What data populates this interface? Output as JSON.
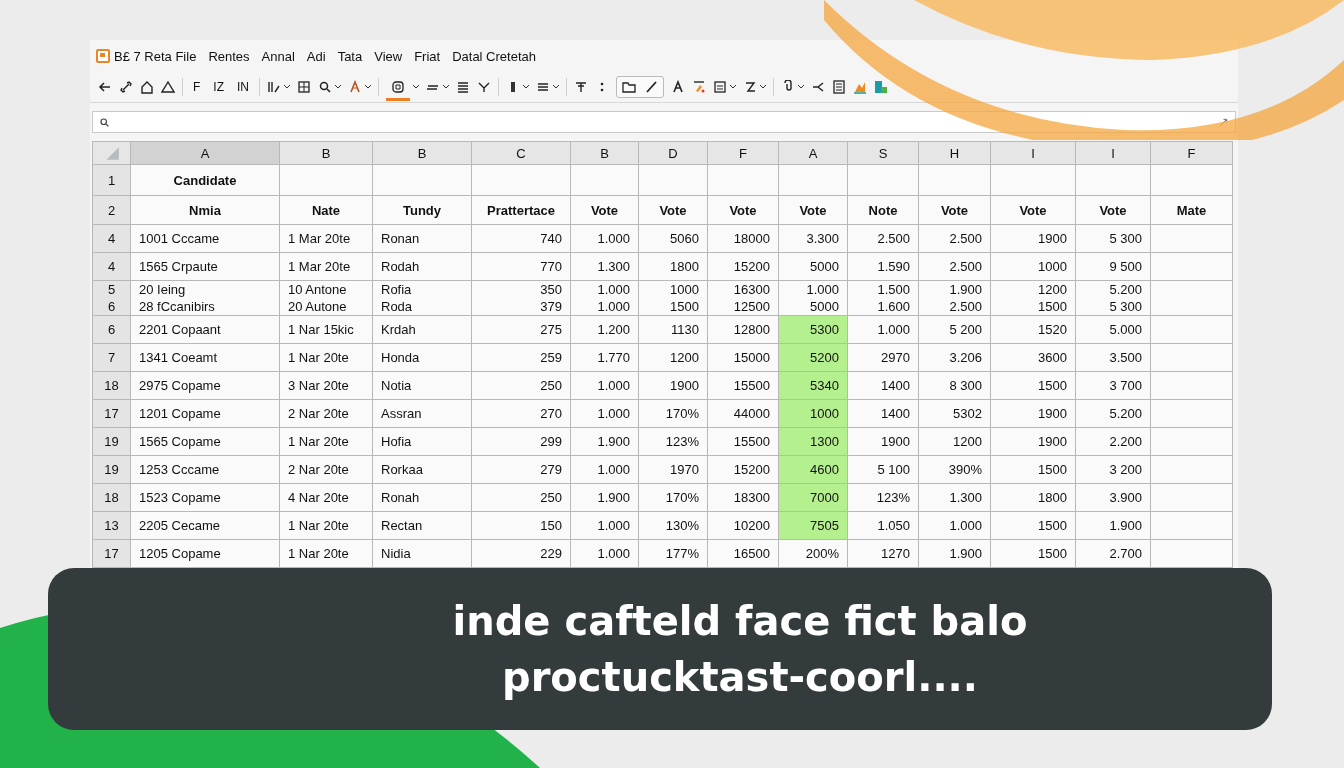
{
  "menu": [
    "B£ 7 Reta File",
    "Rentes",
    "Annal",
    "Adi",
    "Tata",
    "View",
    "Friat",
    "Datal Cretetah"
  ],
  "toolbar_labels": [
    "F",
    "IZ",
    "IN"
  ],
  "columns": [
    "A",
    "B",
    "B",
    "C",
    "B",
    "D",
    "F",
    "A",
    "S",
    "H",
    "I",
    "I",
    "F"
  ],
  "title_row": {
    "header": "1",
    "label": "Candidate"
  },
  "heading_row": {
    "header": "2",
    "labels": [
      "Nmia",
      "Nate",
      "Tundy",
      "Prattertace",
      "Vote",
      "Vote",
      "Vote",
      "Vote",
      "Note",
      "Vote",
      "Vote",
      "Vote",
      "Mate"
    ]
  },
  "rows": [
    {
      "header": "4",
      "highlighted": false,
      "cells": [
        "1001 Cccame",
        "1 Mar 20te",
        "Ronan",
        "740",
        "1.000",
        "5060",
        "18000",
        "3.300",
        "2.500",
        "2.500",
        "1900",
        "5 300"
      ]
    },
    {
      "header": "4",
      "highlighted": false,
      "cells": [
        "1565 Crpaute",
        "1 Mar 20te",
        "Rodah",
        "770",
        "1.300",
        "1800",
        "15200",
        "5000",
        "1.590",
        "2.500",
        "1000",
        "9 500"
      ]
    },
    {
      "header": "5\n6",
      "highlighted": false,
      "cells": [
        "20 Ieing\n28 fCcanibirs",
        "10 Antone\n20 Autone",
        "Rofia\nRoda",
        "350\n379",
        "1.000\n1.000",
        "1000\n1500",
        "16300\n12500",
        "1.000\n5000",
        "1.500\n1.600",
        "1.900\n2.500",
        "1200\n1500",
        "5.200\n5 300"
      ]
    },
    {
      "header": "6",
      "highlighted": true,
      "cells": [
        "2201 Copaant",
        "1 Nar 15kic",
        "Krdah",
        "275",
        "1.200",
        "1130",
        "12800",
        "5300",
        "1.000",
        "5 200",
        "1520",
        "5.000"
      ]
    },
    {
      "header": "7",
      "highlighted": true,
      "cells": [
        "1341 Coeamt",
        "1 Nar 20te",
        "Honda",
        "259",
        "1.770",
        "1200",
        "15000",
        "5200",
        "2970",
        "3.206",
        "3600",
        "3.500"
      ]
    },
    {
      "header": "18",
      "highlighted": true,
      "cells": [
        "2975 Copame",
        "3 Nar 20te",
        "Notia",
        "250",
        "1.000",
        "1900",
        "15500",
        "5340",
        "1400",
        "8 300",
        "1500",
        "3 700"
      ]
    },
    {
      "header": "17",
      "highlighted": true,
      "cells": [
        "1201 Copame",
        "2 Nar 20te",
        "Assran",
        "270",
        "1.000",
        "170%",
        "44000",
        "1000",
        "1400",
        "5302",
        "1900",
        "5.200"
      ]
    },
    {
      "header": "19",
      "highlighted": true,
      "cells": [
        "1565 Copame",
        "1 Nar 20te",
        "Hofia",
        "299",
        "1.900",
        "123%",
        "15500",
        "1300",
        "1900",
        "1200",
        "1900",
        "2.200"
      ]
    },
    {
      "header": "19",
      "highlighted": true,
      "cells": [
        "1253 Cccame",
        "2 Nar 20te",
        "Rorkaa",
        "279",
        "1.000",
        "1970",
        "15200",
        "4600",
        "5 100",
        "390%",
        "1500",
        "3 200"
      ]
    },
    {
      "header": "18",
      "highlighted": true,
      "cells": [
        "1523 Copame",
        "4 Nar 20te",
        "Ronah",
        "250",
        "1.900",
        "170%",
        "18300",
        "7000",
        "123%",
        "1.300",
        "1800",
        "3.900"
      ]
    },
    {
      "header": "13",
      "highlighted": true,
      "cells": [
        "2205 Cecame",
        "1 Nar 20te",
        "Rectan",
        "150",
        "1.000",
        "130%",
        "10200",
        "7505",
        "1.050",
        "1.000",
        "1500",
        "1.900"
      ]
    },
    {
      "header": "17",
      "highlighted": false,
      "cells": [
        "1205 Copame",
        "1 Nar 20te",
        "Nidia",
        "229",
        "1.000",
        "177%",
        "16500",
        "200%",
        "1270",
        "1.900",
        "1500",
        "2.700"
      ]
    }
  ],
  "banner": {
    "lines": [
      "inde cafteld face fict balo",
      "proctucktast-coorl...."
    ]
  }
}
